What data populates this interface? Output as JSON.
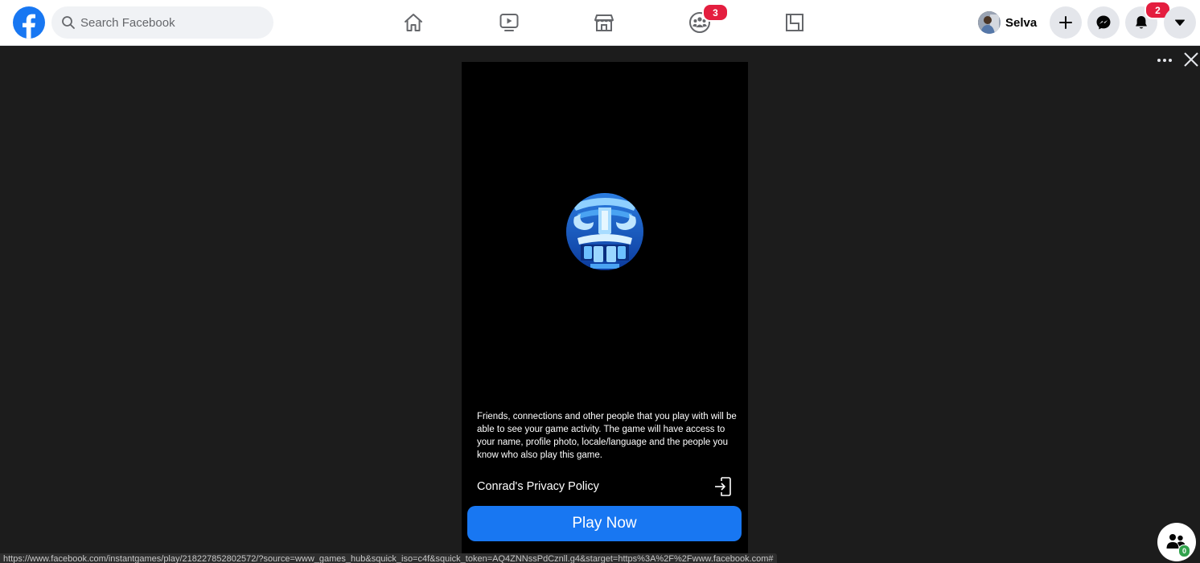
{
  "topbar": {
    "logo_name": "facebook-logo",
    "search": {
      "placeholder": "Search Facebook",
      "value": ""
    },
    "nav_tabs": [
      {
        "id": "home",
        "icon": "home-icon",
        "badge": null
      },
      {
        "id": "watch",
        "icon": "video-play-icon",
        "badge": null
      },
      {
        "id": "marketplace",
        "icon": "marketplace-store-icon",
        "badge": null
      },
      {
        "id": "groups",
        "icon": "groups-icon",
        "badge": "3"
      },
      {
        "id": "gaming",
        "icon": "gaming-square-icon",
        "badge": null
      }
    ],
    "profile": {
      "name": "Selva"
    },
    "actions": [
      {
        "id": "create",
        "icon": "plus-icon",
        "badge": null
      },
      {
        "id": "messenger",
        "icon": "messenger-icon",
        "badge": null
      },
      {
        "id": "notifications",
        "icon": "bell-icon",
        "badge": "2"
      },
      {
        "id": "account",
        "icon": "caret-down-icon",
        "badge": null
      }
    ]
  },
  "viewer": {
    "more_icon": "more-horizontal-icon",
    "close_icon": "close-icon",
    "game": {
      "icon": "game-face-icon",
      "disclaimer": "Friends, connections and other people that you play with will be able to see your game activity. The game will have access to your name, profile photo, locale/language and the people you know who also play this game.",
      "privacy_label": "Conrad's Privacy Policy",
      "privacy_icon": "open-external-icon",
      "play_label": "Play Now"
    },
    "friends_button": {
      "icon": "friends-icon",
      "count": "0"
    }
  },
  "status_bar": {
    "url": "https://www.facebook.com/instantgames/play/218227852802572/?source=www_games_hub&squick_iso=c4f&squick_token=AQ4ZNNssPdCznll.g4&starget=https%3A%2F%2Fwww.facebook.com#"
  },
  "colors": {
    "brand": "#1877f2",
    "badge": "#e41e3f",
    "online": "#31a24c",
    "viewer_bg": "#1c1c1c",
    "game_bg": "#000000"
  }
}
